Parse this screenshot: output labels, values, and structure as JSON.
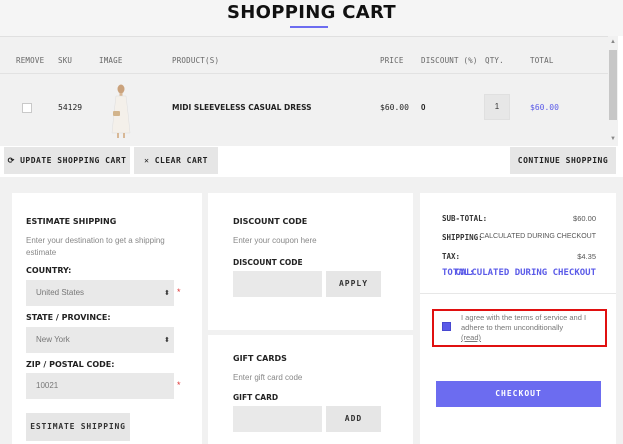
{
  "page_title": "SHOPPING CART",
  "table": {
    "headers": [
      "REMOVE",
      "SKU",
      "IMAGE",
      "PRODUCT(S)",
      "PRICE",
      "DISCOUNT (%)",
      "QTY.",
      "TOTAL"
    ],
    "rows": [
      {
        "sku": "54129",
        "product": "MIDI SLEEVELESS CASUAL DRESS",
        "price": "$60.00",
        "discount": "0",
        "qty": "1",
        "total": "$60.00"
      }
    ]
  },
  "actions": {
    "update_label": "UPDATE SHOPPING CART",
    "clear_label": "CLEAR CART",
    "continue_label": "CONTINUE SHOPPING"
  },
  "shipping": {
    "title": "ESTIMATE SHIPPING",
    "hint": "Enter your destination to get a shipping estimate",
    "country_label": "COUNTRY:",
    "country_value": "United States",
    "state_label": "STATE / PROVINCE:",
    "state_value": "New York",
    "zip_label": "ZIP / POSTAL CODE:",
    "zip_value": "10021",
    "button_label": "ESTIMATE SHIPPING"
  },
  "discount": {
    "title": "DISCOUNT CODE",
    "hint": "Enter your coupon here",
    "field_label": "DISCOUNT CODE",
    "apply_label": "APPLY"
  },
  "gift": {
    "title": "GIFT CARDS",
    "hint": "Enter gift card code",
    "field_label": "GIFT CARD",
    "add_label": "ADD"
  },
  "summary": {
    "subtotal_label": "SUB-TOTAL:",
    "subtotal_value": "$60.00",
    "shipping_label": "SHIPPING:",
    "shipping_value": "CALCULATED DURING CHECKOUT",
    "tax_label": "TAX:",
    "tax_value": "$4.35",
    "total_label": "TOTAL:",
    "total_value": "CALCULATED DURING CHECKOUT",
    "agree_text": "I agree with the terms of service and I adhere to them unconditionally",
    "read_link": "(read)",
    "checkout_label": "CHECKOUT"
  },
  "colors": {
    "accent": "#6c6cf0",
    "highlight_border": "#e01010"
  }
}
